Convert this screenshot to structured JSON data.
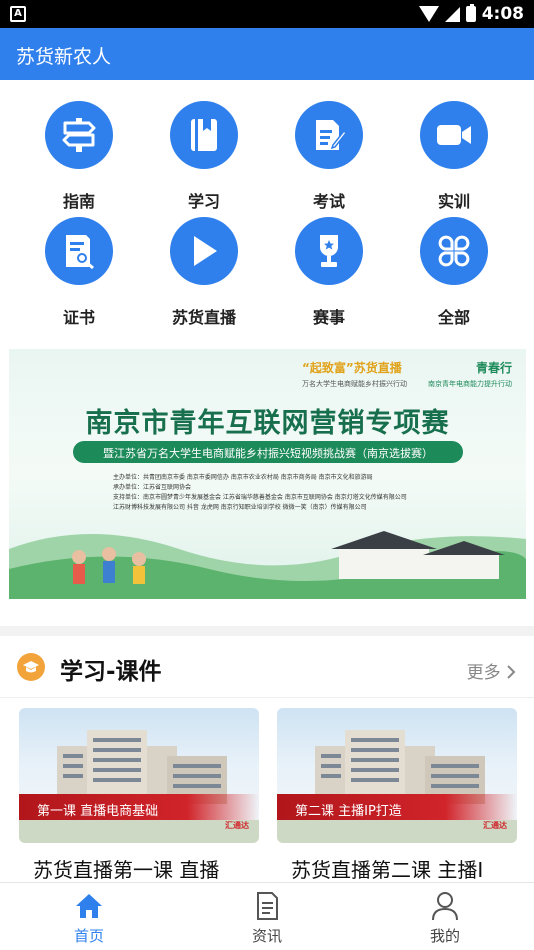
{
  "status_bar": {
    "time": "4:08",
    "left_icon": "A"
  },
  "app": {
    "title": "苏货新农人"
  },
  "menu": [
    {
      "label": "指南",
      "icon": "signpost-icon"
    },
    {
      "label": "学习",
      "icon": "book-icon"
    },
    {
      "label": "考试",
      "icon": "exam-icon"
    },
    {
      "label": "实训",
      "icon": "video-camera-icon"
    },
    {
      "label": "证书",
      "icon": "certificate-icon"
    },
    {
      "label": "苏货直播",
      "icon": "play-icon"
    },
    {
      "label": "赛事",
      "icon": "trophy-icon"
    },
    {
      "label": "全部",
      "icon": "grid-all-icon"
    }
  ],
  "banner": {
    "brand_left": "“起致富”苏货直播",
    "brand_right": "青春行",
    "brand_left_sub": "万名大学生电商赋能乡村振兴行动",
    "brand_right_sub": "南京青年电商能力提升行动",
    "title": "南京市青年互联网营销专项赛",
    "subtitle": "暨江苏省万名大学生电商赋能乡村振兴短视频挑战赛（南京选拔赛）",
    "info_lines": [
      "主办单位：共青团南京市委  南京市委网信办  南京市农业农村局  南京市商务局  南京市文化和旅游局",
      "承办单位：江苏省互联网协会",
      "支持单位：南京市圆梦青少年发展基金会  江苏省瑞华慈善基金会  南京市互联网协会  南京灯塔文化传媒有限公司",
      "江苏财博科技发展有限公司  抖音  龙虎网  南京行知职业培训学校  微微一笑（南京）传媒有限公司"
    ]
  },
  "section": {
    "title": "学习-课件",
    "more": "更多"
  },
  "courses": [
    {
      "thumb_text": "第一课 直播电商基础",
      "logo": "汇通达",
      "title": "苏货直播第一课 直播"
    },
    {
      "thumb_text": "第二课 主播IP打造",
      "logo": "汇通达",
      "title": "苏货直播第二课 主播I"
    }
  ],
  "bottom_nav": [
    {
      "label": "首页",
      "icon": "home-icon",
      "active": true
    },
    {
      "label": "资讯",
      "icon": "news-icon",
      "active": false
    },
    {
      "label": "我的",
      "icon": "user-icon",
      "active": false
    }
  ],
  "colors": {
    "primary": "#2f80ed",
    "accent_orange": "#f2a33a",
    "banner_green": "#176f4d",
    "course_red": "#d0242a"
  }
}
